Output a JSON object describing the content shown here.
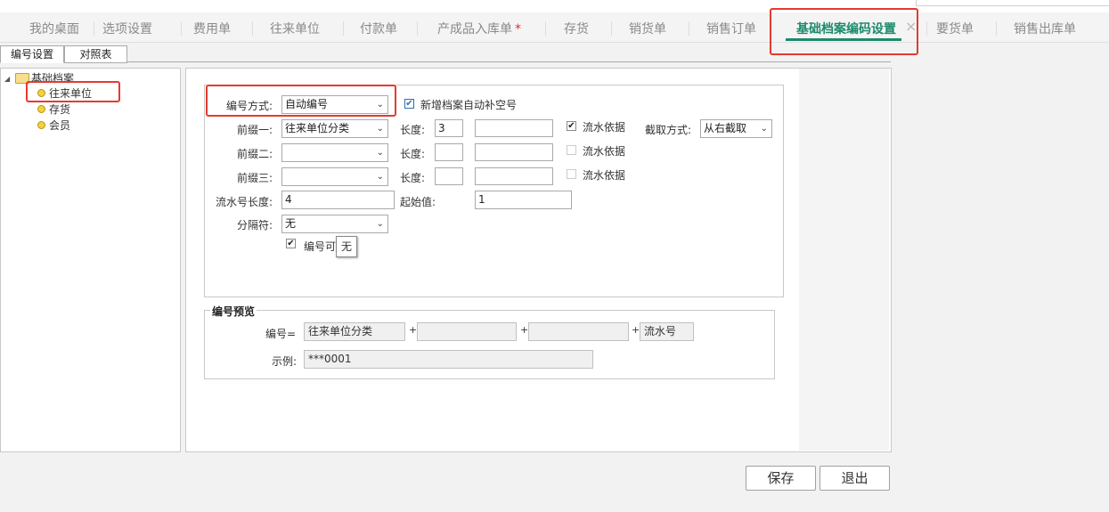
{
  "header": {
    "cut_title": ""
  },
  "tabs": [
    {
      "label": "我的桌面"
    },
    {
      "label": "选项设置"
    },
    {
      "label": "费用单"
    },
    {
      "label": "往来单位"
    },
    {
      "label": "付款单"
    },
    {
      "label": "产成品入库单",
      "star": "*"
    },
    {
      "label": "存货"
    },
    {
      "label": "销货单"
    },
    {
      "label": "销售订单"
    },
    {
      "label": "基础档案编码设置",
      "active": true,
      "close": "×"
    },
    {
      "label": "要货单"
    },
    {
      "label": "销售出库单"
    }
  ],
  "subtabs": [
    {
      "label": "编号设置"
    },
    {
      "label": "对照表"
    }
  ],
  "tree": {
    "root": "基础档案",
    "items": [
      {
        "label": "往来单位"
      },
      {
        "label": "存货"
      },
      {
        "label": "会员"
      }
    ]
  },
  "form": {
    "method_label": "编号方式:",
    "method_value": "自动编号",
    "autofill_checkbox": "新增档案自动补空号",
    "prefix1_label": "前缀一:",
    "prefix1_value": "往来单位分类",
    "prefix2_label": "前缀二:",
    "prefix3_label": "前缀三:",
    "length_label": "长度:",
    "prefix1_length": "3",
    "serial_basis_label": "流水依据",
    "cut_method_label": "截取方式:",
    "cut_method_value": "从右截取",
    "serial_length_label": "流水号长度:",
    "serial_length_value": "4",
    "start_label": "起始值:",
    "start_value": "1",
    "separator_label": "分隔符:",
    "separator_value": "无",
    "editable_checkbox": "编号可",
    "tooltip": "无"
  },
  "preview": {
    "legend": "编号预览",
    "code_label": "编号=",
    "part1": "往来单位分类",
    "plus": "+",
    "part4": "流水号",
    "example_label": "示例:",
    "example_value": "***0001"
  },
  "buttons": {
    "save": "保存",
    "exit": "退出"
  },
  "colors": {
    "accent": "#1b8a6b",
    "highlight_box": "#e53a2f"
  },
  "icons": {
    "check": "✔",
    "chevron": "⌄",
    "collapse": "◢"
  }
}
